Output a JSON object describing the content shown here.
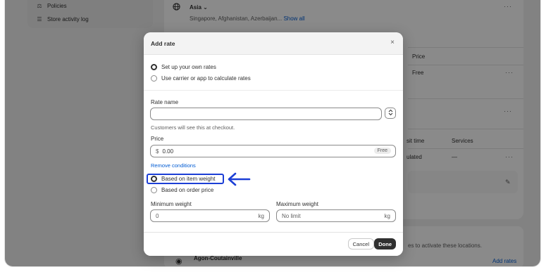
{
  "sidebar": {
    "items": [
      {
        "icon": "policies-icon",
        "label": "Policies"
      },
      {
        "icon": "list-icon",
        "label": "Store activity log"
      }
    ]
  },
  "background": {
    "zone_name": "Asia",
    "zone_chevron": "⌄",
    "zone_countries": "Singapore, Afghanistan, Azerbaijan...",
    "show_all": "Show all",
    "col_price": "Price",
    "row_price": "Free",
    "col_transit": "sit time",
    "col_services": "Services",
    "row_transit": "ulated",
    "row_services": "—",
    "activate_text": "es to activate these locations.",
    "location_name": "Agon-Coutainville",
    "add_rates": "Add rates",
    "dots": "···"
  },
  "modal": {
    "title": "Add rate",
    "close": "×",
    "rate_type_options": [
      {
        "label": "Set up your own rates",
        "checked": true
      },
      {
        "label": "Use carrier or app to calculate rates",
        "checked": false
      }
    ],
    "rate_name_label": "Rate name",
    "rate_name_value": "",
    "stepper_up": "⌃",
    "stepper_down": "⌄",
    "rate_name_help": "Customers will see this at checkout.",
    "price_label": "Price",
    "price_prefix": "$",
    "price_value": "0.00",
    "price_badge": "Free",
    "remove_conditions": "Remove conditions",
    "condition_options": [
      {
        "label": "Based on item weight",
        "checked": true
      },
      {
        "label": "Based on order price",
        "checked": false
      }
    ],
    "min_weight_label": "Minimum weight",
    "min_weight_value": "0",
    "min_weight_unit": "kg",
    "max_weight_label": "Maximum weight",
    "max_weight_placeholder": "No limit",
    "max_weight_unit": "kg",
    "cancel_label": "Cancel",
    "done_label": "Done"
  },
  "colors": {
    "annotation": "#1c3fd6",
    "link": "#005bd3",
    "primary_button": "#303030"
  }
}
